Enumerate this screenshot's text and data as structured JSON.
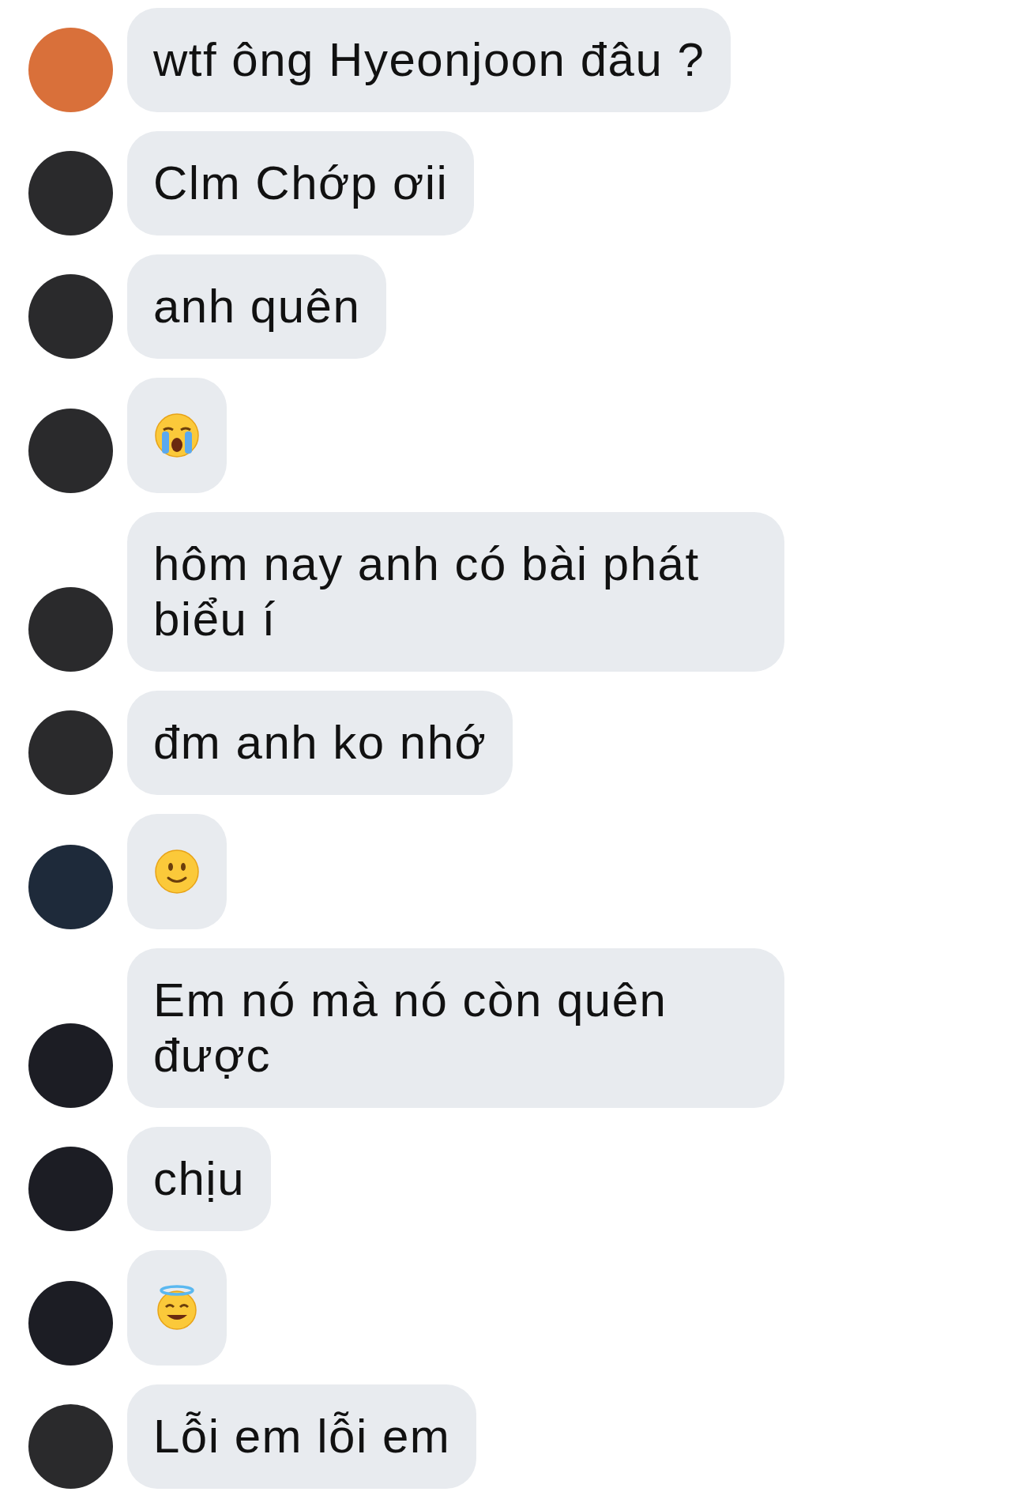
{
  "messages": [
    {
      "kind": "text",
      "text": "wtf ông Hyeonjoon đâu ?",
      "color": "#d9703a"
    },
    {
      "kind": "text",
      "text": "Clm Chớp ơii",
      "color": "#2a2a2c"
    },
    {
      "kind": "text",
      "text": "anh quên",
      "color": "#2a2a2c"
    },
    {
      "kind": "crying_emoji",
      "color": "#2a2a2c"
    },
    {
      "kind": "text",
      "text": "hôm nay anh có bài phát biểu í",
      "color": "#2a2a2c"
    },
    {
      "kind": "text",
      "text": "đm anh ko nhớ",
      "color": "#2a2a2c"
    },
    {
      "kind": "smile_emoji",
      "color": "#1e2a3a"
    },
    {
      "kind": "text",
      "text": "Em nó mà nó còn quên được",
      "color": "#1c1d24"
    },
    {
      "kind": "text",
      "text": "chịu",
      "color": "#1c1d24"
    },
    {
      "kind": "halo_emoji",
      "color": "#1c1d24"
    },
    {
      "kind": "text",
      "text": "Lỗi em lỗi em",
      "color": "#2a2a2c"
    }
  ]
}
